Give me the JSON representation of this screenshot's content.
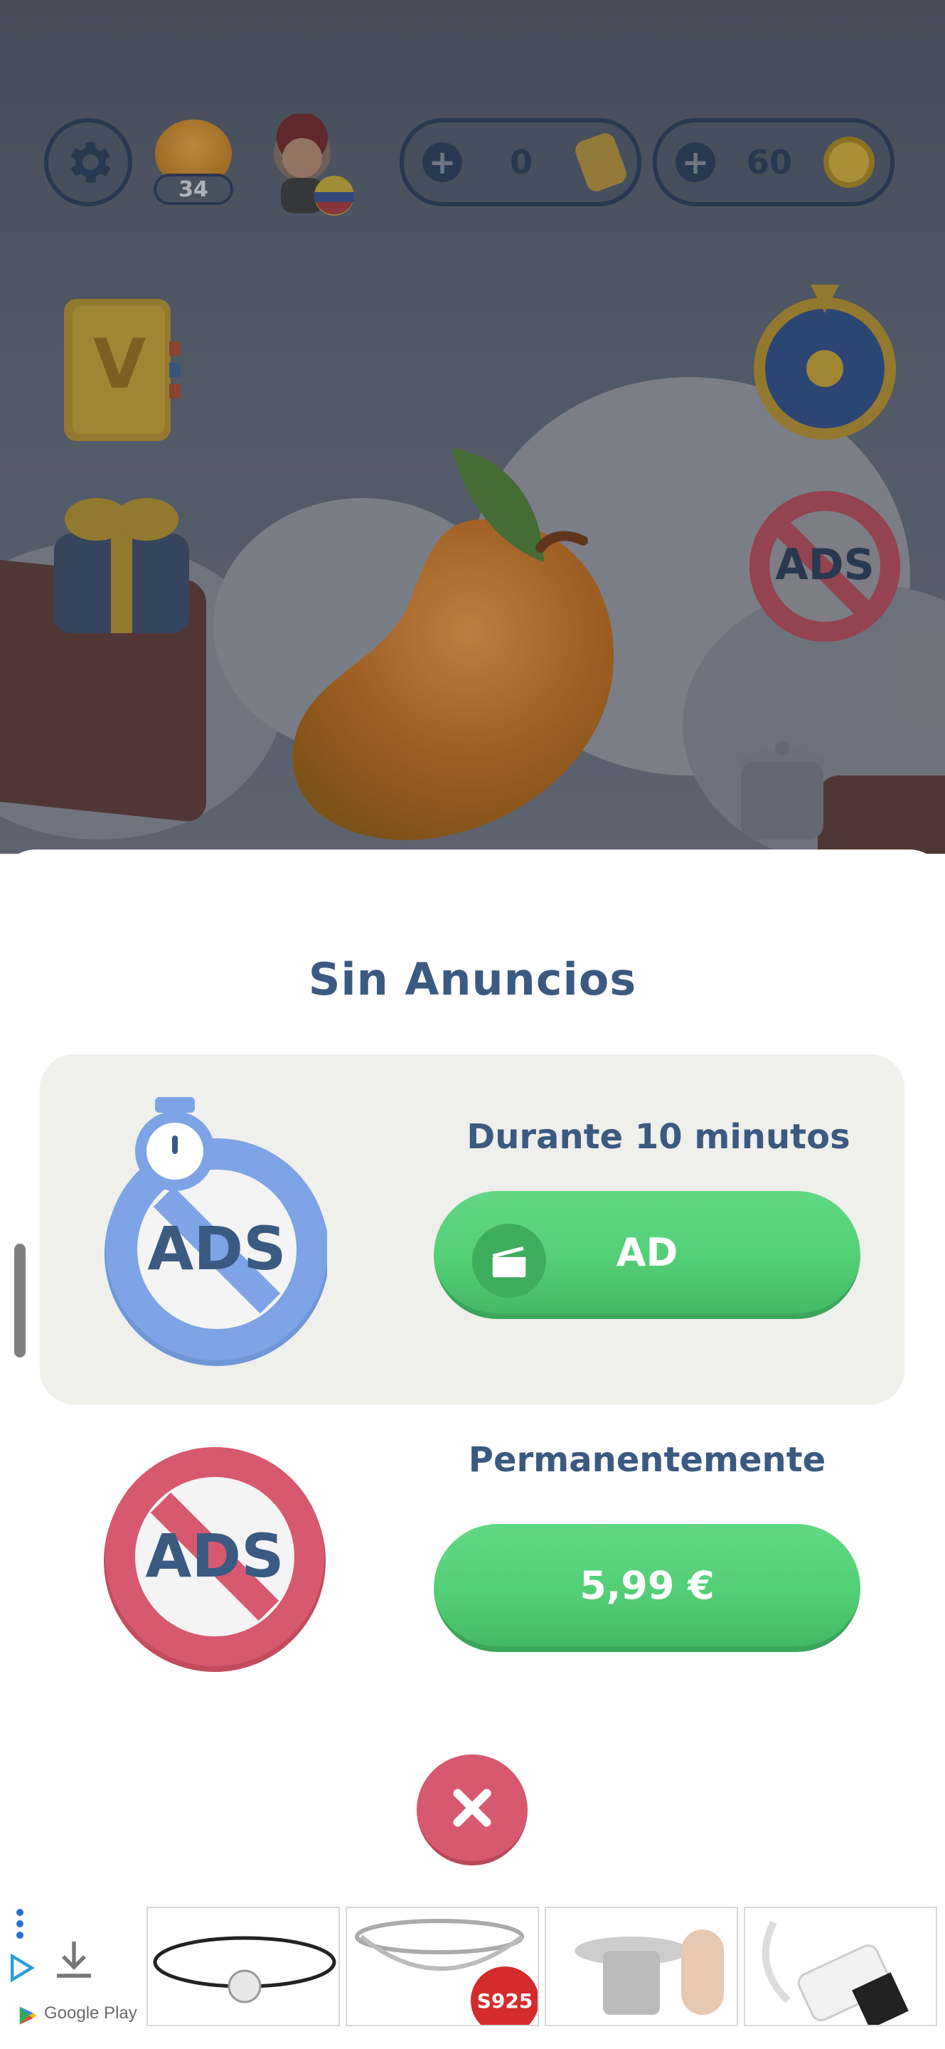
{
  "hud": {
    "level": "34",
    "currency_a": "0",
    "currency_b": "60"
  },
  "sheet": {
    "title": "Sin Anuncios",
    "option_timed": {
      "label": "Durante 10 minutos",
      "button_label": "AD",
      "icon_text": "ADS"
    },
    "option_permanent": {
      "label": "Permanentemente",
      "button_label": "5,99 €",
      "icon_text": "ADS"
    }
  },
  "side_icons": {
    "no_ads_text": "ADS"
  },
  "ad_banner": {
    "store_label": "Google Play",
    "badge_text": "S925"
  },
  "colors": {
    "title": "#3a5a82",
    "green_button": "#53cf77",
    "close_button": "#d7596f",
    "ads_blue": "#7ea3e6",
    "ads_red": "#d7596f"
  }
}
